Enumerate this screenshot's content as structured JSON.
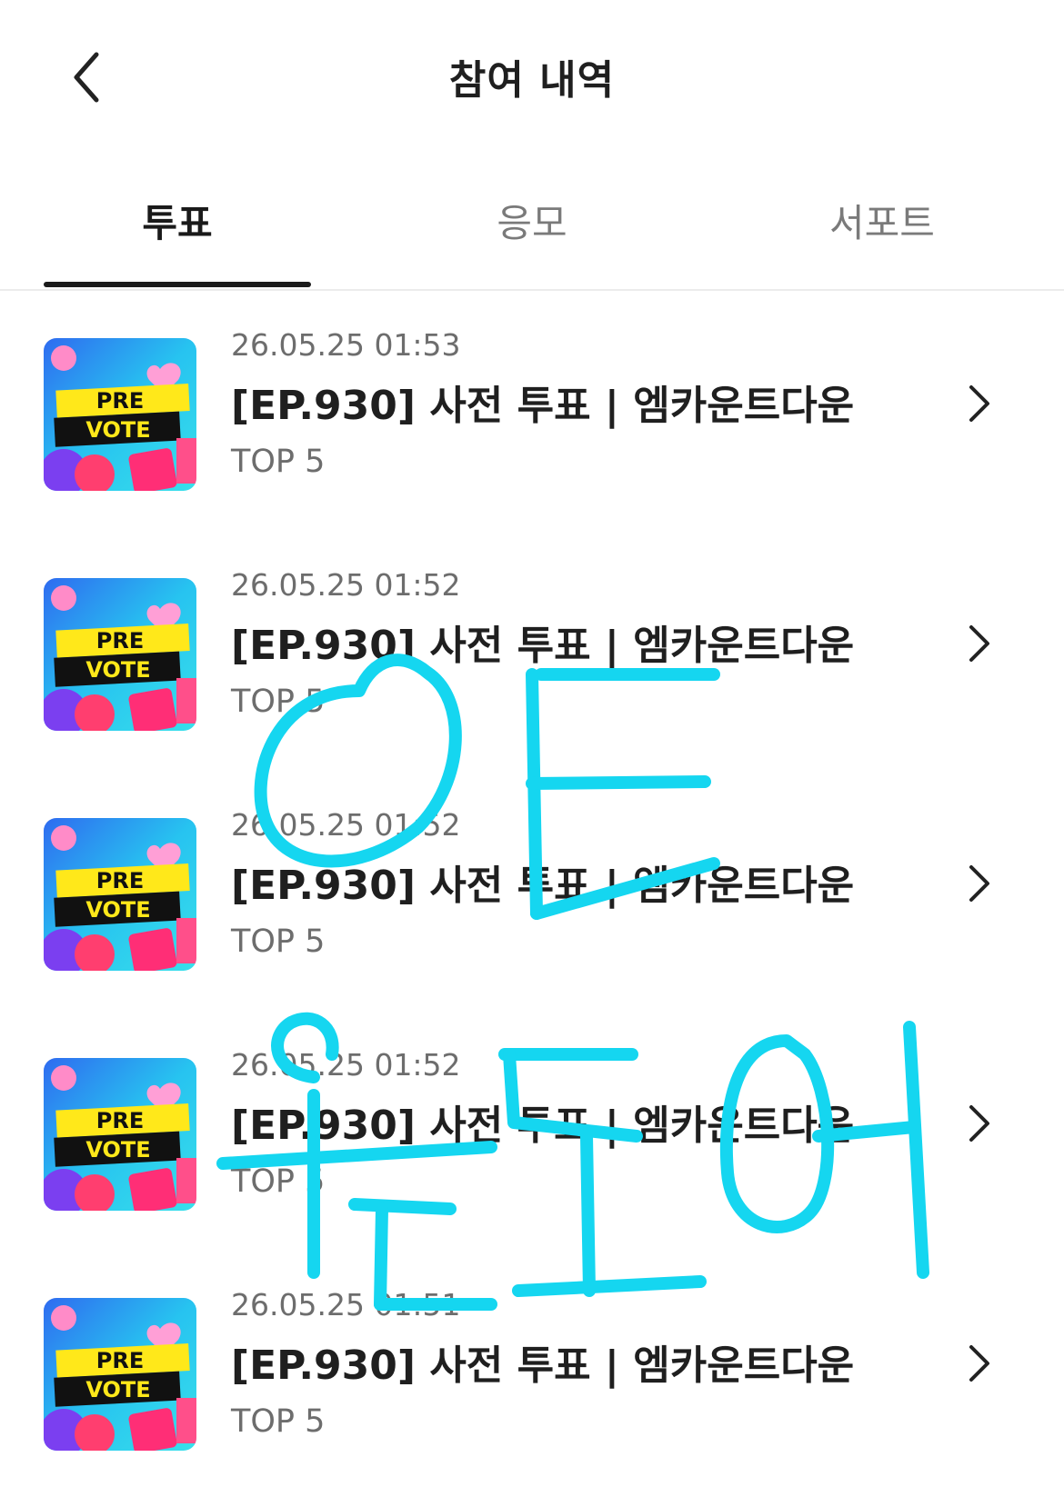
{
  "header": {
    "title": "참여 내역",
    "back_icon": "chevron-left-icon"
  },
  "tabs": [
    {
      "label": "투표",
      "active": true
    },
    {
      "label": "응모",
      "active": false
    },
    {
      "label": "서포트",
      "active": false
    }
  ],
  "thumbnail": {
    "line1": "PRE",
    "line2": "VOTE"
  },
  "items": [
    {
      "date": "26.05.25 01:53",
      "title": "[EP.930] 사전 투표 | 엠카운트다운",
      "rank": "TOP 5"
    },
    {
      "date": "26.05.25 01:52",
      "title": "[EP.930] 사전 투표 | 엠카운트다운",
      "rank": "TOP 5"
    },
    {
      "date": "26.05.25 01:52",
      "title": "[EP.930] 사전 투표 | 엠카운트다운",
      "rank": "TOP 5"
    },
    {
      "date": "26.05.25 01:52",
      "title": "[EP.930] 사전 투표 | 엠카운트다운",
      "rank": "TOP 5"
    },
    {
      "date": "26.05.25 01:51",
      "title": "[EP.930] 사전 투표 | 엠카운트다운",
      "rank": "TOP 5"
    }
  ],
  "colors": {
    "accent": "#1b1b1b",
    "scribble": "#15d6f0"
  }
}
